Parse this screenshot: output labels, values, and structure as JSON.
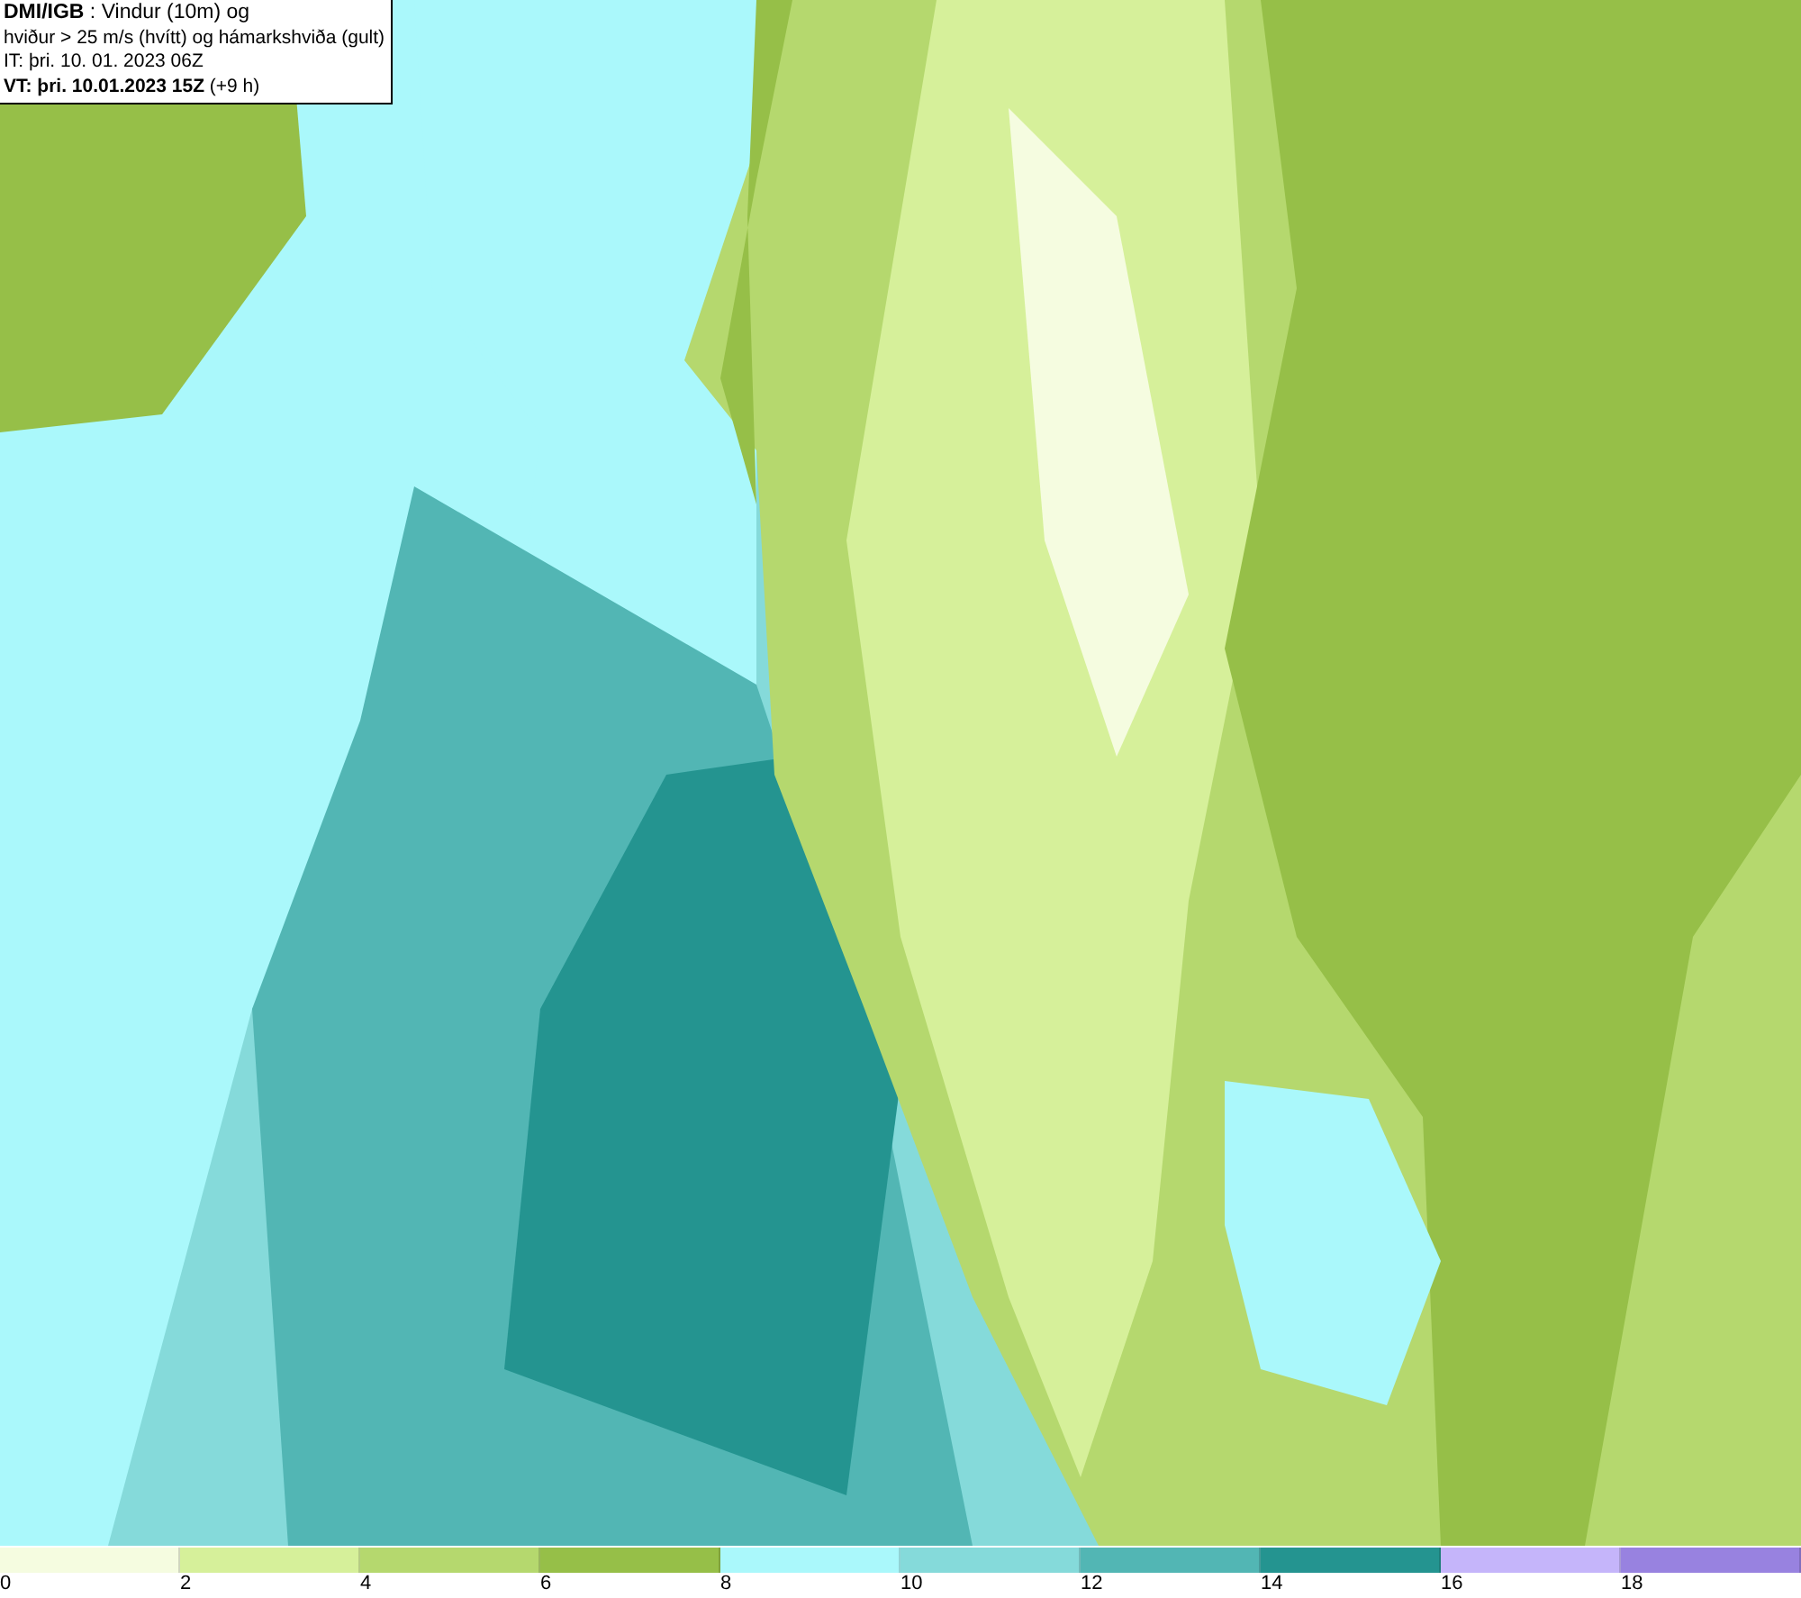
{
  "header": {
    "lines": [
      "**DMI/IGB** : Vindur (10m) og",
      "hviður > 25 m/s (hvítt) og hámarkshviða (gult)",
      "IT: þri. 10. 01. 2023 06Z",
      "**VT: þri. 10.01.2023 15Z** (+9 h)"
    ]
  },
  "legend": [
    {
      "label": "0",
      "color": "#f5fce0"
    },
    {
      "label": "2",
      "color": "#d6f09a"
    },
    {
      "label": "4",
      "color": "#b5d86e"
    },
    {
      "label": "6",
      "color": "#96bf48"
    },
    {
      "label": "8",
      "color": "#aaf8fb"
    },
    {
      "label": "10",
      "color": "#85dada"
    },
    {
      "label": "12",
      "color": "#52b6b4"
    },
    {
      "label": "14",
      "color": "#249490"
    },
    {
      "label": "16",
      "color": "#c5b5fa"
    },
    {
      "label": "18",
      "color": "#9882e0"
    }
  ]
}
